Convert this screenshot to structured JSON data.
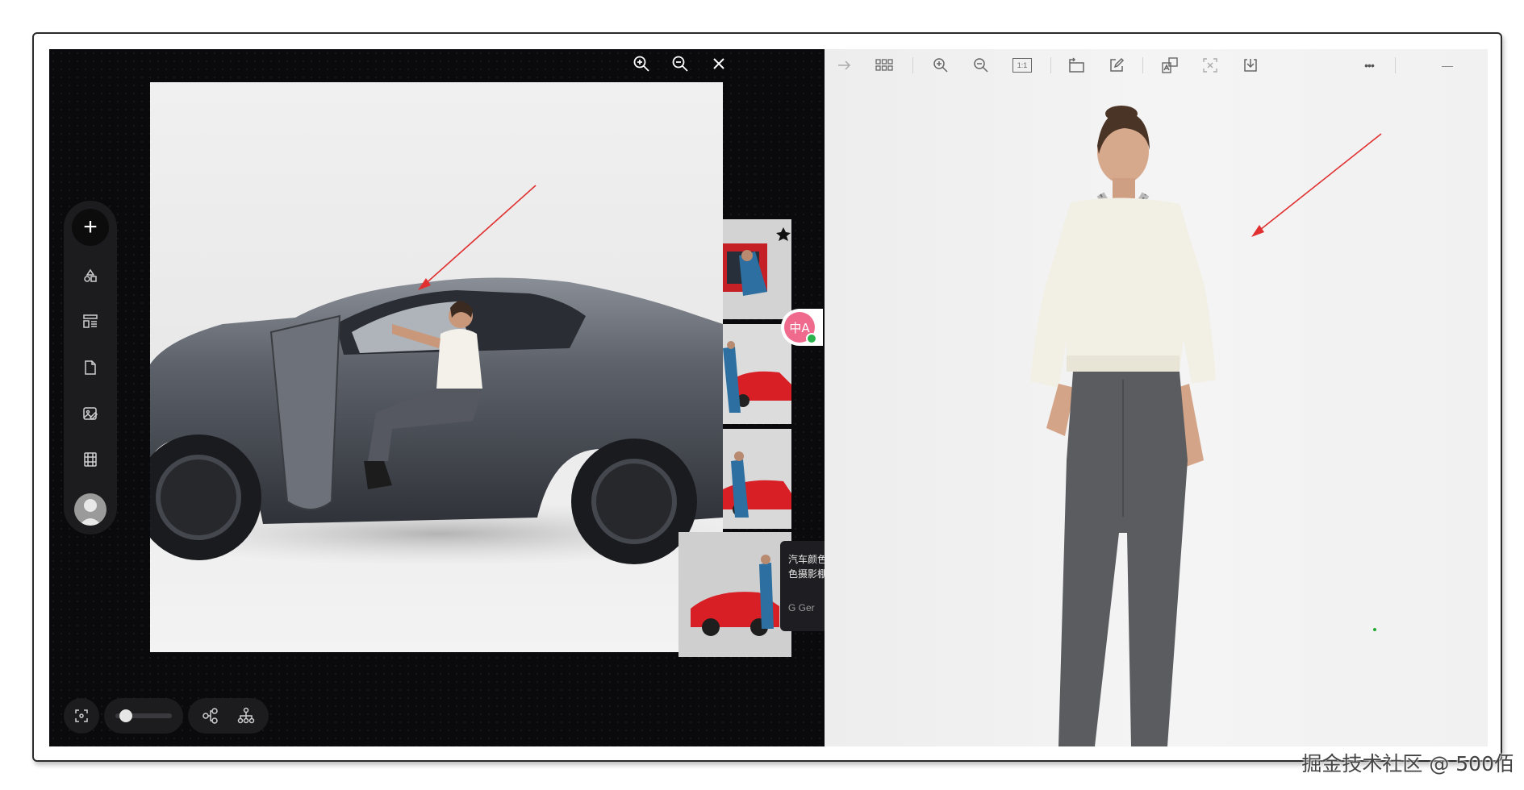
{
  "left_panel": {
    "top_tools": [
      {
        "name": "zoom-in-icon"
      },
      {
        "name": "zoom-out-icon"
      },
      {
        "name": "close-icon"
      }
    ],
    "sidebar": {
      "add_symbol": "+",
      "items": [
        {
          "icon": "shapes-icon"
        },
        {
          "icon": "layout-icon"
        },
        {
          "icon": "document-icon"
        },
        {
          "icon": "image-edit-icon"
        },
        {
          "icon": "film-icon"
        }
      ],
      "avatar": "user-avatar-icon"
    },
    "bottom_bar": {
      "items": [
        "fit-screen-icon",
        "zoom-slider",
        "node-graph-icon",
        "hierarchy-icon"
      ],
      "zoom_level": 0.1
    },
    "translate_badge_text": "中A",
    "tooltip": {
      "line1": "汽车颜色",
      "line2": "色摄影棚",
      "button": "G  Ger"
    }
  },
  "right_panel": {
    "toolbar": [
      "forward-arrow-icon",
      "grid-icon",
      "zoom-in-icon",
      "zoom-out-icon",
      "actual-size-icon",
      "rotate-icon",
      "edit-icon",
      "translate-image-icon",
      "scan-icon",
      "download-icon",
      "more-icon",
      "minimize-icon"
    ],
    "more_text": "•••",
    "actual_size_text": "1:1",
    "minimize_text": "—"
  },
  "watermark": "掘金技术社区 @ 500佰",
  "colors": {
    "canvas_bg": "#0a0a0c",
    "sidebar_bg": "#1c1c1f",
    "annotation_arrow": "#e03030",
    "car_body": "#5f646d",
    "red_car": "#d81f26",
    "translate_badge": "#f06a8e"
  }
}
